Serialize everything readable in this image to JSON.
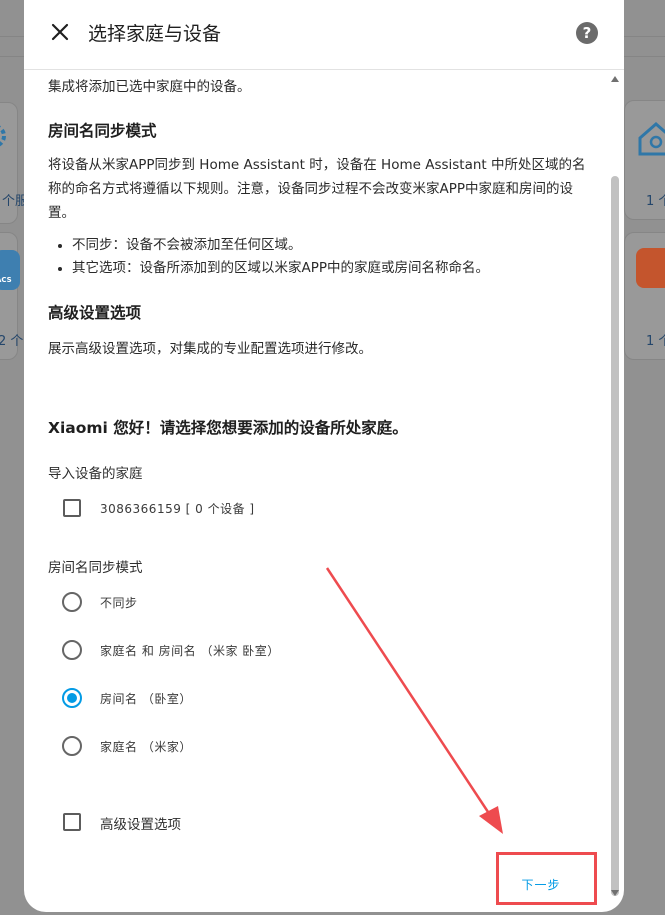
{
  "background": {
    "left_cards": [
      "个服",
      "2 个"
    ],
    "right_cards": [
      "1 个",
      "1 个"
    ],
    "left_logo_text": "ACS"
  },
  "dialog": {
    "title": "选择家庭与设备",
    "help_symbol": "?",
    "intro": "集成将添加已选中家庭中的设备。",
    "room_sync": {
      "heading": "房间名同步模式",
      "description": "将设备从米家APP同步到 Home Assistant 时，设备在 Home Assistant 中所处区域的名称的命名方式将遵循以下规则。注意，设备同步过程不会改变米家APP中家庭和房间的设置。",
      "bullets": [
        "不同步：设备不会被添加至任何区域。",
        "其它选项：设备所添加到的区域以米家APP中的家庭或房间名称命名。"
      ]
    },
    "advanced": {
      "heading": "高级设置选项",
      "description": "展示高级设置选项，对集成的专业配置选项进行修改。"
    },
    "greeting": "Xiaomi 您好！请选择您想要添加的设备所处家庭。",
    "home_field": {
      "label": "导入设备的家庭",
      "option": "3086366159 [ 0 个设备 ]",
      "checked": false
    },
    "room_field": {
      "label": "房间名同步模式",
      "options": [
        "不同步",
        "家庭名 和 房间名 （米家 卧室）",
        "房间名 （卧室）",
        "家庭名 （米家）"
      ],
      "selected_index": 2
    },
    "advanced_checkbox": {
      "label": "高级设置选项",
      "checked": false
    },
    "next_label": "下一步"
  },
  "colors": {
    "accent": "#039be5",
    "annotation": "#ee4b4f"
  }
}
